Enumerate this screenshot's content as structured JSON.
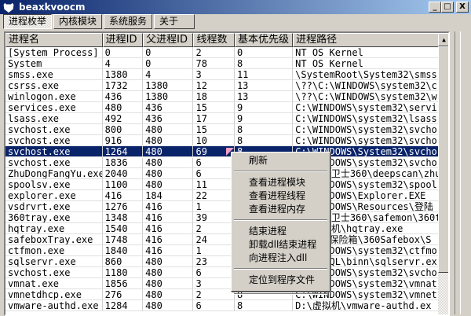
{
  "window": {
    "title": "beaxkvoocm",
    "minimize": "_",
    "maximize": "□",
    "close": "X"
  },
  "tabs": [
    {
      "label": "进程枚举",
      "active": true
    },
    {
      "label": "内核模块"
    },
    {
      "label": "系统服务"
    },
    {
      "label": "关于"
    }
  ],
  "columns": [
    "进程名",
    "进程ID",
    "父进程ID",
    "线程数",
    "基本优先级",
    "进程路径"
  ],
  "rows": [
    [
      "[System Process]",
      "0",
      "0",
      "2",
      "0",
      "NT OS Kernel"
    ],
    [
      "System",
      "4",
      "0",
      "78",
      "8",
      "NT OS Kernel"
    ],
    [
      "smss.exe",
      "1380",
      "4",
      "3",
      "11",
      "\\SystemRoot\\System32\\smss"
    ],
    [
      "csrss.exe",
      "1732",
      "1380",
      "12",
      "13",
      "\\??\\C:\\WINDOWS\\system32\\c"
    ],
    [
      "winlogon.exe",
      "436",
      "1380",
      "18",
      "13",
      "\\??\\C:\\WINDOWS\\system32\\w"
    ],
    [
      "services.exe",
      "480",
      "436",
      "15",
      "9",
      "C:\\WINDOWS\\system32\\servi"
    ],
    [
      "lsass.exe",
      "492",
      "436",
      "17",
      "9",
      "C:\\WINDOWS\\system32\\lsass"
    ],
    [
      "svchost.exe",
      "800",
      "480",
      "15",
      "8",
      "C:\\WINDOWS\\system32\\svcho"
    ],
    [
      "svchost.exe",
      "916",
      "480",
      "10",
      "8",
      "C:\\WINDOWS\\system32\\svcho"
    ],
    [
      "svchost.exe",
      "1264",
      "480",
      "69",
      "8",
      "C:\\WINDOWS\\System32\\svcho"
    ],
    [
      "svchost.exe",
      "1836",
      "480",
      "6",
      "",
      "C:\\WINDOWS\\system32\\svcho"
    ],
    [
      "ZhuDongFangYu.exe",
      "2040",
      "480",
      "6",
      "",
      "C:\\安全卫士360\\deepscan\\zhudo"
    ],
    [
      "spoolsv.exe",
      "1100",
      "480",
      "11",
      "",
      "C:\\WINDOWS\\system32\\spool"
    ],
    [
      "explorer.exe",
      "416",
      "184",
      "22",
      "",
      "C:\\WINDOWS\\Explorer.EXE"
    ],
    [
      "vsdrvrt.exe",
      "1276",
      "416",
      "1",
      "",
      "C:\\WINDOWS\\Resources\\登陆"
    ],
    [
      "360tray.exe",
      "1348",
      "416",
      "39",
      "",
      "C:\\安全卫士360\\safemon\\360tra"
    ],
    [
      "hqtray.exe",
      "1540",
      "416",
      "2",
      "",
      "D:\\虚拟机\\hqtray.exe"
    ],
    [
      "safeboxTray.exe",
      "1748",
      "416",
      "24",
      "",
      "C:\\360保险箱\\360Safebox\\S"
    ],
    [
      "ctfmon.exe",
      "1840",
      "416",
      "1",
      "",
      "C:\\WINDOWS\\system32\\ctfmo"
    ],
    [
      "sqlservr.exe",
      "860",
      "480",
      "23",
      "",
      "C:\\MSSQL\\binn\\sqlservr.ex"
    ],
    [
      "svchost.exe",
      "1180",
      "480",
      "6",
      "",
      "C:\\WINDOWS\\system32\\svcho"
    ],
    [
      "vmnat.exe",
      "1856",
      "480",
      "3",
      "",
      "C:\\WINDOWS\\system32\\vmnat"
    ],
    [
      "vmnetdhcp.exe",
      "276",
      "480",
      "2",
      "8",
      "C:\\WINDOWS\\system32\\vmnet"
    ],
    [
      "vmware-authd.exe",
      "1284",
      "480",
      "6",
      "8",
      "D:\\虚拟机\\vmware-authd.ex"
    ]
  ],
  "selected_row": 9,
  "context_menu": [
    [
      "刷新"
    ],
    [
      "查看进程模块",
      "查看进程线程",
      "查看进程内存"
    ],
    [
      "结束进程",
      "卸载dll结束进程",
      "向进程注入dll"
    ],
    [
      "定位到程序文件"
    ]
  ],
  "colors": {
    "title_start": "#0a246a",
    "title_end": "#a6caf0",
    "selection": "#0a246a",
    "face": "#d4d0c8"
  }
}
